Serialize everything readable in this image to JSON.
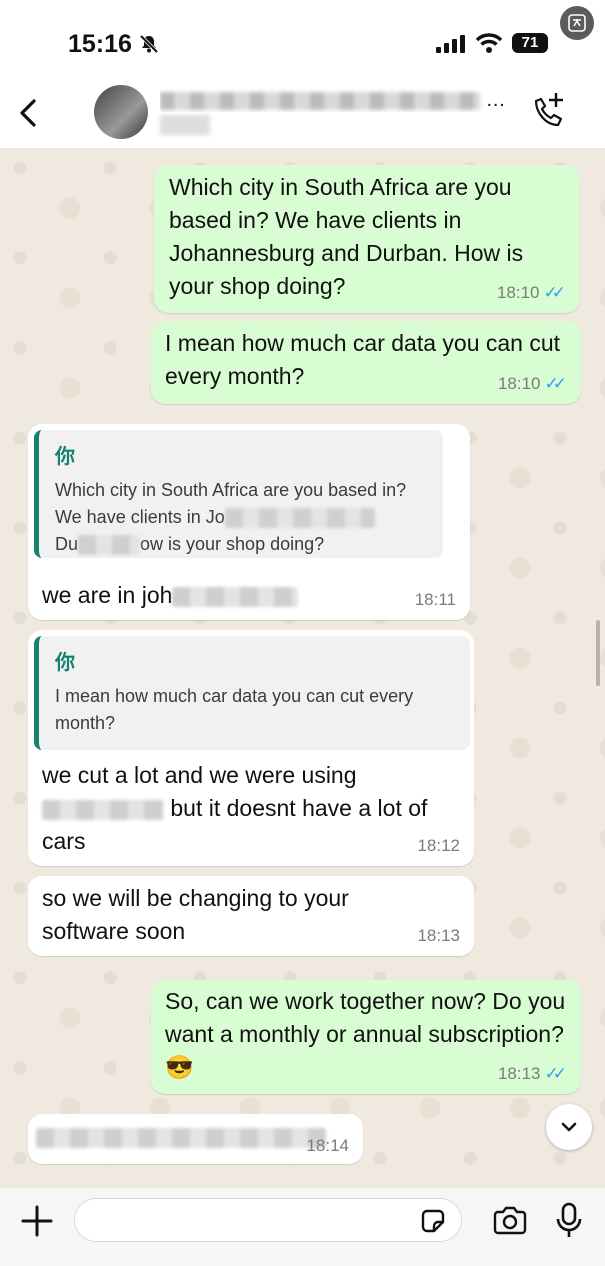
{
  "status_bar": {
    "time": "15:16",
    "battery": "71"
  },
  "header": {
    "contact_name_visible": "…"
  },
  "messages": [
    {
      "direction": "out",
      "text": "Which city in South Africa are you based in? We have clients in Johannesburg and Durban. How is your shop doing?",
      "time": "18:10"
    },
    {
      "direction": "out",
      "text": "I mean how much car data you can cut every month?",
      "time": "18:10"
    },
    {
      "direction": "in",
      "quote_author": "你",
      "quote_line1": "Which city in South Africa are you based in?",
      "quote_line2_prefix": "We have clients in Jo",
      "quote_line3_prefix": "Du",
      "quote_line3_suffix": "ow is your shop doing?",
      "text_prefix": "we are in joh",
      "time": "18:11"
    },
    {
      "direction": "in",
      "quote_author": "你",
      "quote_text": "I mean how much car data you can cut every month?",
      "text_line1": "we cut a lot and we were using",
      "text_line2_suffix": "but it doesnt have a lot of",
      "text_line3": "cars",
      "time": "18:12"
    },
    {
      "direction": "in",
      "text": "so we will be changing to your software soon",
      "time": "18:13"
    },
    {
      "direction": "out",
      "text": "So, can we work together now? Do you want a monthly or annual subscription?😎",
      "time": "18:13"
    },
    {
      "direction": "in",
      "time_partial": "18:14"
    }
  ],
  "icons": {
    "back": "chevron-left-icon",
    "call": "add-call-icon",
    "plus": "plus-icon",
    "sticker": "sticker-icon",
    "camera": "camera-icon",
    "mic": "microphone-icon",
    "scroll": "chevron-down-icon",
    "translate": "translate-icon"
  },
  "colors": {
    "outgoing_bubble": "#d9fdd3",
    "incoming_bubble": "#ffffff",
    "quote_accent": "#15826b",
    "read_ticks": "#34a0e8",
    "chat_background": "#efe9df"
  }
}
